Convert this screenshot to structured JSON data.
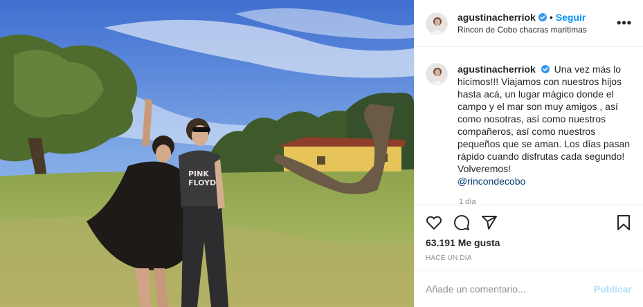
{
  "post": {
    "username": "agustinacherriok",
    "follow_label": "Seguir",
    "separator": "•",
    "location": "Rincon de Cobo chacras maritimas",
    "more_icon": "more-options-icon",
    "caption_username": "agustinacherriok",
    "caption_text": "Una vez más lo hicimos!!! Viajamos con nuestros hijos hasta acá, un lugar mágico donde el campo y el mar son muy amigos , así como nosotras, así como nuestros compañeros, así como nuestros pequeños que se aman. Los días pasan rápido cuando disfrutas cada segundo! Volveremos!",
    "caption_mention": "@rincondecobo",
    "partial_time": "1 día",
    "likes": "63.191 Me gusta",
    "timestamp": "HACE UN DÍA",
    "comment_placeholder": "Añade un comentario...",
    "publish_label": "Publicar"
  },
  "icons": {
    "like": "heart-icon",
    "comment": "comment-icon",
    "share": "share-icon",
    "save": "bookmark-icon",
    "verified": "verified-badge-icon"
  },
  "colors": {
    "accent": "#0095f6",
    "verified": "#3897f0",
    "publish_disabled": "#b2dffc",
    "mention": "#00376b",
    "secondary_text": "#8e8e8e"
  }
}
